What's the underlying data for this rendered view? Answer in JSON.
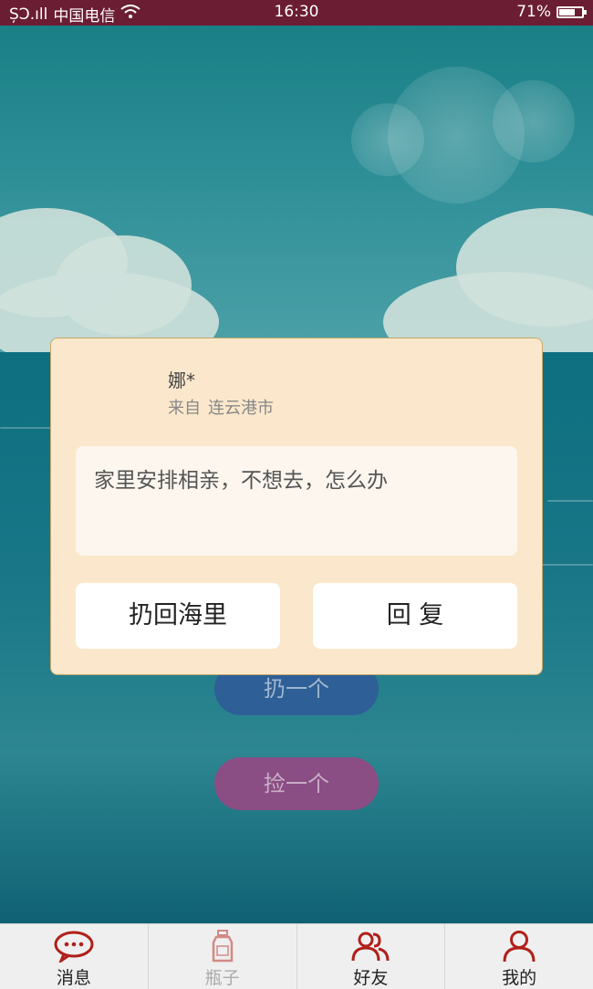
{
  "status_bar": {
    "signal": "ȘƆ.ıll",
    "carrier": "中国电信",
    "time": "16:30",
    "battery": "71%",
    "battery_level": 0.71
  },
  "background_buttons": {
    "throw_label": "扔一个",
    "pick_label": "捡一个"
  },
  "dialog": {
    "sender_name": "娜*",
    "from_prefix": "来自",
    "from_city": "连云港市",
    "message": "家里安排相亲，不想去，怎么办",
    "throw_back_label": "扔回海里",
    "reply_label": "回 复"
  },
  "tabs": [
    {
      "label": "消息",
      "icon": "message-bubble-icon",
      "active": true
    },
    {
      "label": "瓶子",
      "icon": "bottle-icon",
      "active": false
    },
    {
      "label": "好友",
      "icon": "friends-icon",
      "active": true
    },
    {
      "label": "我的",
      "icon": "person-icon",
      "active": true
    }
  ],
  "colors": {
    "status_bar": "#6b1d33",
    "dialog_bg": "#fbe8cc",
    "icon_red": "#b0201a"
  }
}
